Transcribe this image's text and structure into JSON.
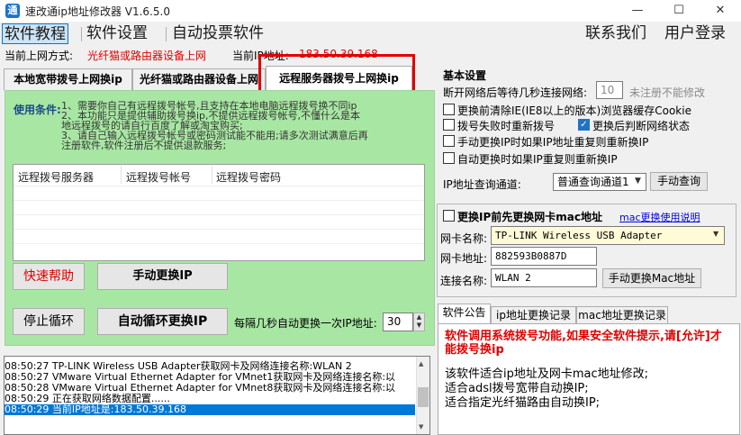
{
  "window": {
    "title": "速改通ip地址修改器 V1.6.5.0",
    "icon_letter": "通",
    "minimize": "—",
    "maximize": "☐",
    "close": "✕"
  },
  "menu": {
    "items": [
      "软件教程",
      "软件设置",
      "自动投票软件"
    ],
    "right_items": [
      "联系我们",
      "用户登录"
    ]
  },
  "status": {
    "mode_label": "当前上网方式:",
    "mode_value": "光纤猫或路由器设备上网",
    "ip_label": "当前IP地址:",
    "ip_value": "183.50.39.168"
  },
  "left_tabs": [
    "本地宽带拨号上网换ip",
    "光纤猫或路由器设备上网",
    "远程服务器拨号上网换ip"
  ],
  "usage": {
    "title": "使用条件:",
    "lines": [
      "1、需要你自己有远程拨号帐号,且支持在本地电脑远程拨号换不同ip",
      "2、本功能只是提供辅助拨号换ip,不提供远程拨号帐号,不懂什么是本",
      "地远程拨号的请自行百度了解或淘宝购买;",
      "3、请自己输入远程拨号帐号或密码测试能不能用;请多次测试满意后再",
      "注册软件,软件注册后不提供退款服务;"
    ]
  },
  "table": {
    "columns": [
      "远程拨号服务器",
      "远程拨号帐号",
      "远程拨号密码"
    ]
  },
  "buttons": {
    "help": "快速帮助",
    "manual_change": "手动更换IP",
    "stop_loop": "停止循环",
    "auto_loop": "自动循环更换IP",
    "interval_label": "每隔几秒自动更换一次IP地址:",
    "interval_value": "30"
  },
  "settings": {
    "title": "基本设置",
    "wait_label": "断开网络后等待几秒连接网络:",
    "wait_value": "10",
    "wait_note": "未注册不能修改",
    "options": [
      {
        "label": "更换前清除IE(IE8以上的版本)浏览器缓存Cookie",
        "checked": false
      },
      {
        "label": "拨号失败时重新拨号",
        "checked": false
      },
      {
        "label": "更换后判断网络状态",
        "checked": true
      },
      {
        "label": "手动更换IP时如果IP地址重复则重新换IP",
        "checked": false
      },
      {
        "label": "自动更换时如果IP重复则重新换IP",
        "checked": false
      }
    ],
    "query_label": "IP地址查询通道:",
    "query_value": "普通查询通道1",
    "query_button": "手动查询"
  },
  "mac": {
    "header_label": "更换IP前先更换网卡mac地址",
    "help_link": "mac更换使用说明",
    "nic_label": "网卡名称:",
    "nic_value": "TP-LINK Wireless USB Adapter",
    "addr_label": "网卡地址:",
    "addr_value": "882593B0887D",
    "conn_label": "连接名称:",
    "conn_value": "WLAN 2",
    "change_button": "手动更换Mac地址"
  },
  "right_tabs": [
    "软件公告",
    "ip地址更换记录",
    "mac地址更换记录"
  ],
  "notice": {
    "red_text": "软件调用系统拨号功能,如果安全软件提示,请[允许]才能拨号换ip",
    "lines": [
      "该软件适合ip地址及网卡mac地址修改;",
      "适合adsl拨号宽带自动换IP;",
      "适合指定光纤猫路由自动换IP;"
    ]
  },
  "log": [
    "08:50:27 TP-LINK Wireless USB Adapter获取网卡及网络连接名称:WLAN 2",
    "08:50:27 VMware Virtual Ethernet Adapter for VMnet1获取网卡及网络连接名称:以",
    "08:50:28 VMware Virtual Ethernet Adapter for VMnet8获取网卡及网络连接名称:以",
    "08:50:29 正在获取网络数据配置......",
    "08:50:29 当前IP地址是:183.50.39.168"
  ],
  "colors": {
    "accent": "#0078d7",
    "panel_green": "#a8e7a3",
    "alert_red": "#e00000"
  }
}
